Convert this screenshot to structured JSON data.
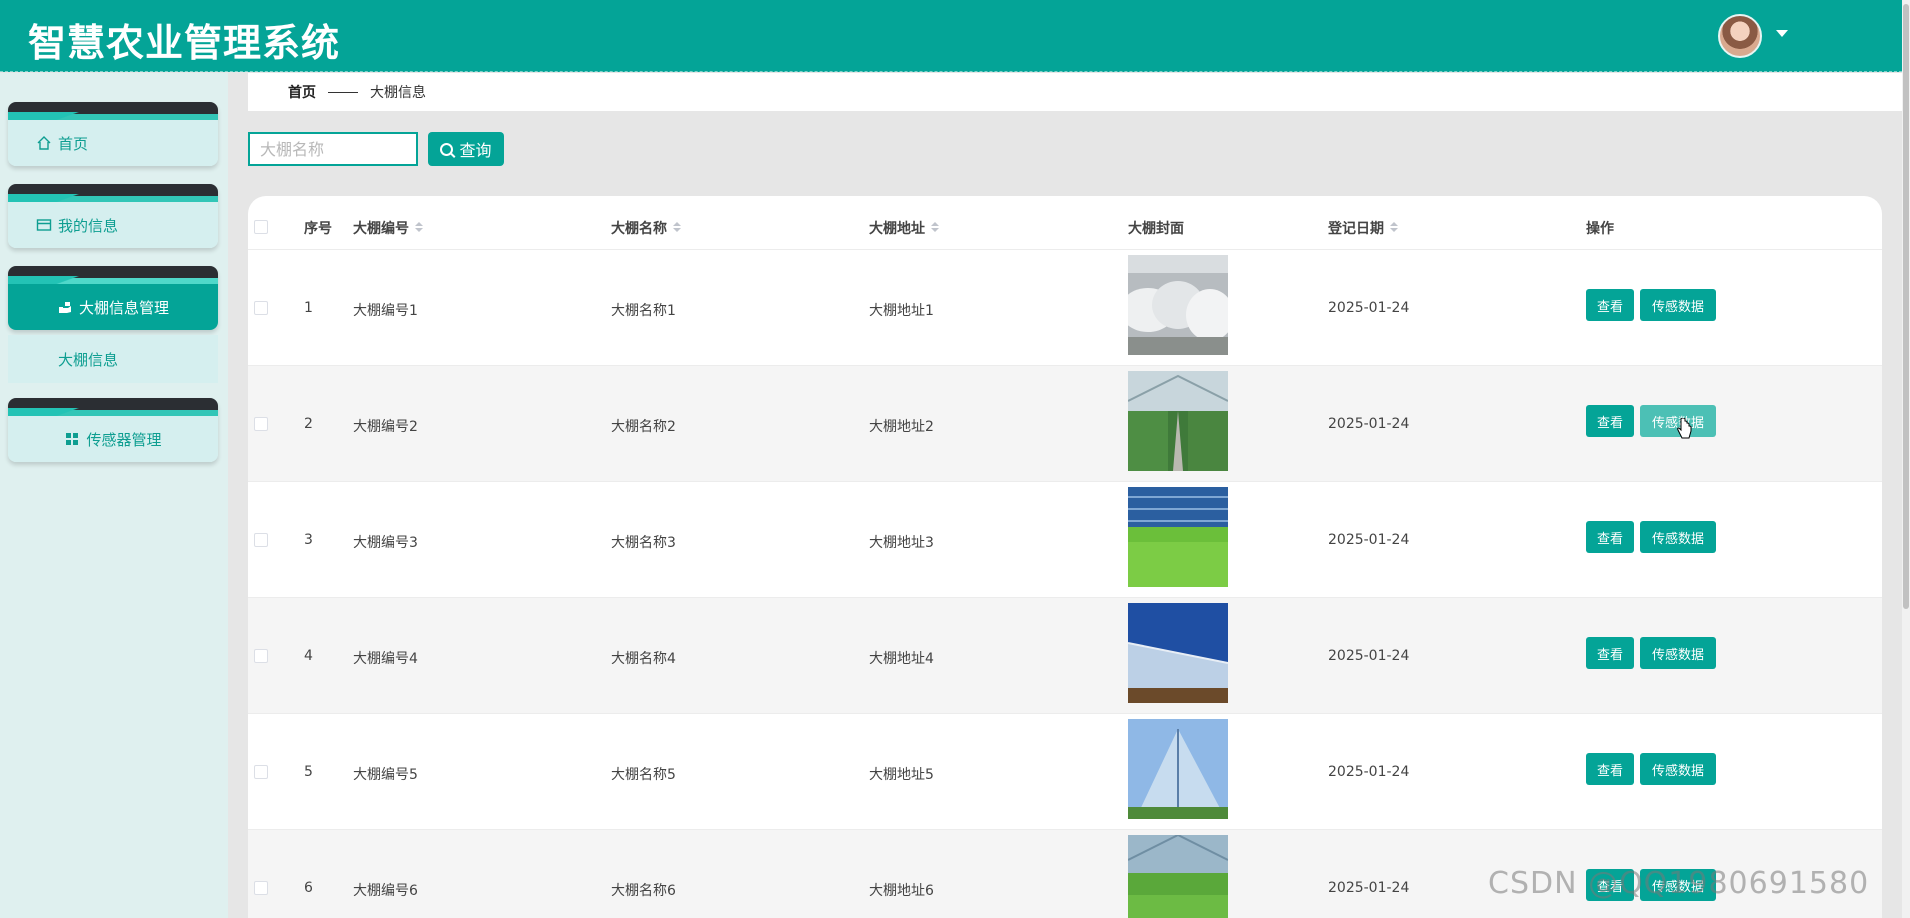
{
  "header": {
    "title": "智慧农业管理系统"
  },
  "sidebar": {
    "items": [
      {
        "label": "首页",
        "icon": "home-icon"
      },
      {
        "label": "我的信息",
        "icon": "card-icon"
      },
      {
        "label": "大棚信息管理",
        "icon": "hand-icon",
        "active": true
      },
      {
        "label": "传感器管理",
        "icon": "grid-icon"
      }
    ],
    "sub_item": "大棚信息"
  },
  "breadcrumb": {
    "home": "首页",
    "current": "大棚信息"
  },
  "search": {
    "placeholder": "大棚名称",
    "button": "查询"
  },
  "table": {
    "columns": [
      "序号",
      "大棚编号",
      "大棚名称",
      "大棚地址",
      "大棚封面",
      "登记日期",
      "操作"
    ],
    "rows": [
      {
        "no": "1",
        "code": "大棚编号1",
        "name": "大棚名称1",
        "addr": "大棚地址1",
        "date": "2025-01-24"
      },
      {
        "no": "2",
        "code": "大棚编号2",
        "name": "大棚名称2",
        "addr": "大棚地址2",
        "date": "2025-01-24"
      },
      {
        "no": "3",
        "code": "大棚编号3",
        "name": "大棚名称3",
        "addr": "大棚地址3",
        "date": "2025-01-24"
      },
      {
        "no": "4",
        "code": "大棚编号4",
        "name": "大棚名称4",
        "addr": "大棚地址4",
        "date": "2025-01-24"
      },
      {
        "no": "5",
        "code": "大棚编号5",
        "name": "大棚名称5",
        "addr": "大棚地址5",
        "date": "2025-01-24"
      },
      {
        "no": "6",
        "code": "大棚编号6",
        "name": "大棚名称6",
        "addr": "大棚地址6",
        "date": "2025-01-24"
      }
    ],
    "actions": {
      "view": "查看",
      "sensor": "传感数据"
    }
  },
  "watermark": "CSDN @QQ1980691580",
  "colors": {
    "primary": "#04a497",
    "sidebar_bg": "#dff0ef",
    "menu_cap": "#2b2e33"
  }
}
